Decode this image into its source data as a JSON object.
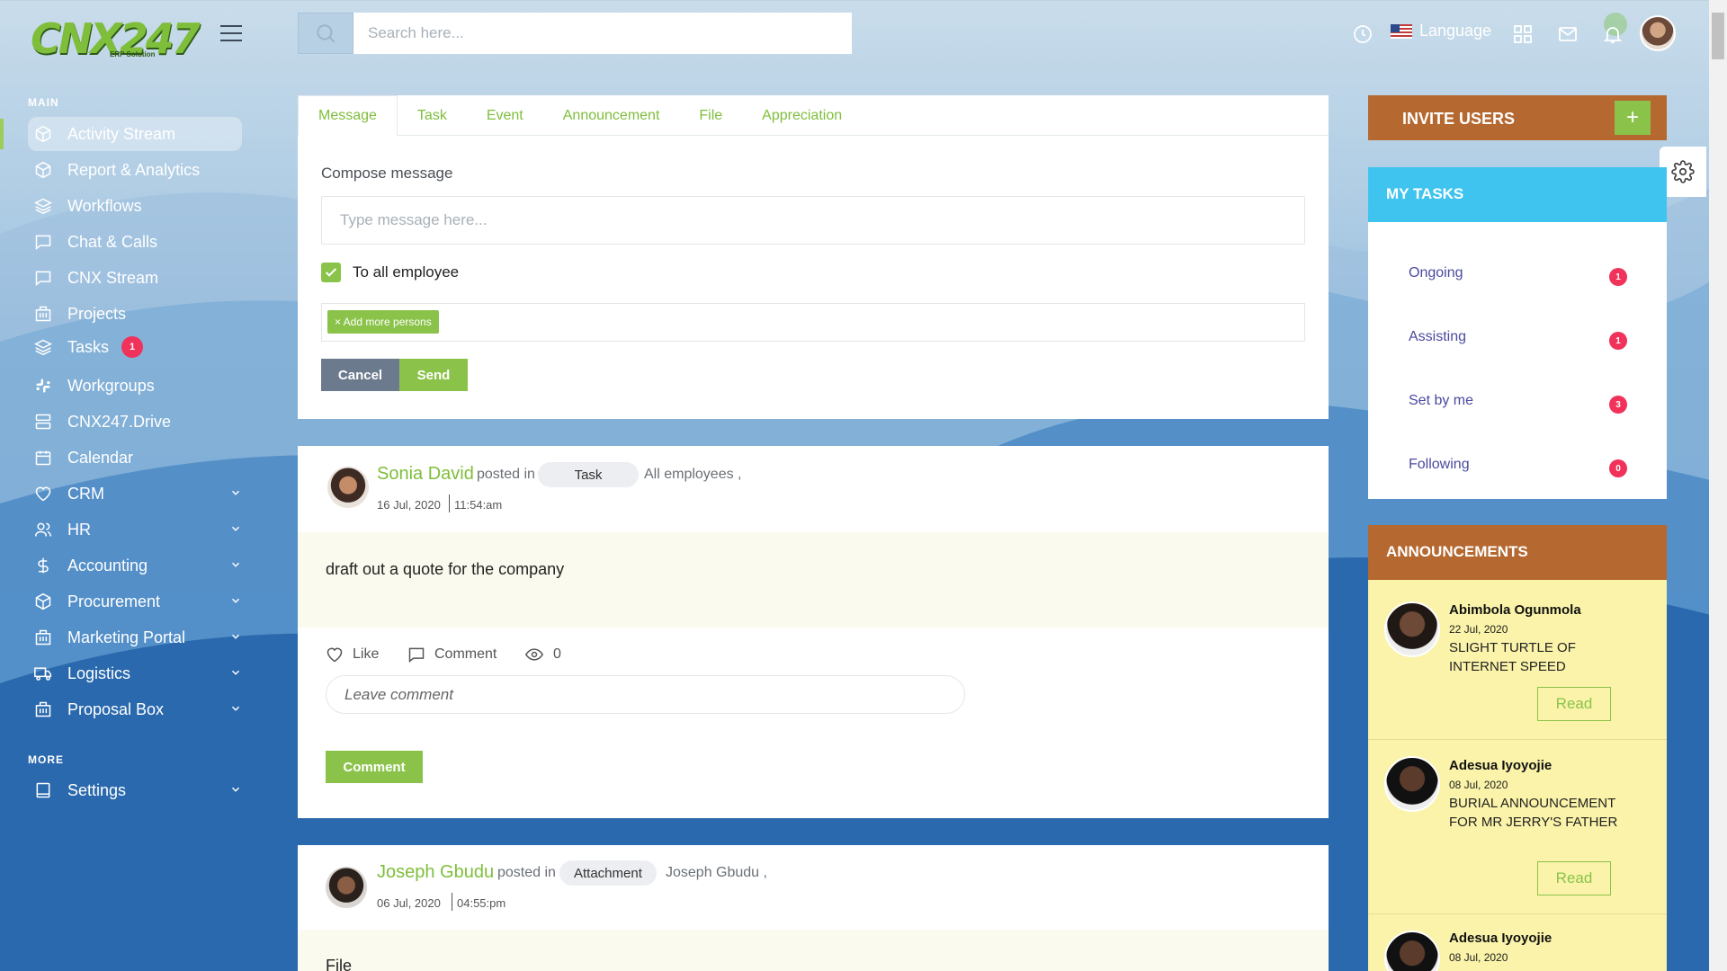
{
  "app": {
    "logo_text": "CNX247",
    "logo_sub": "ERP Solution"
  },
  "search": {
    "placeholder": "Search here..."
  },
  "topbar": {
    "language_label": "Language"
  },
  "sidebar": {
    "main_title": "MAIN",
    "more_title": "MORE",
    "items": [
      {
        "label": "Activity Stream",
        "icon": "cube-icon",
        "active": true
      },
      {
        "label": "Report & Analytics",
        "icon": "cube-icon"
      },
      {
        "label": "Workflows",
        "icon": "layers-icon"
      },
      {
        "label": "Chat & Calls",
        "icon": "chat-icon"
      },
      {
        "label": "CNX Stream",
        "icon": "chat-icon"
      },
      {
        "label": "Projects",
        "icon": "building-icon"
      },
      {
        "label": "Tasks",
        "icon": "layers-icon",
        "badge": "1"
      },
      {
        "label": "Workgroups",
        "icon": "slack-icon"
      },
      {
        "label": "CNX247.Drive",
        "icon": "server-icon"
      },
      {
        "label": "Calendar",
        "icon": "calendar-icon"
      },
      {
        "label": "CRM",
        "icon": "heart-icon",
        "expandable": true
      },
      {
        "label": "HR",
        "icon": "users-icon",
        "expandable": true
      },
      {
        "label": "Accounting",
        "icon": "dollar-icon",
        "expandable": true
      },
      {
        "label": "Procurement",
        "icon": "cube-icon",
        "expandable": true
      },
      {
        "label": "Marketing Portal",
        "icon": "building-icon",
        "expandable": true
      },
      {
        "label": "Logistics",
        "icon": "truck-icon",
        "expandable": true
      },
      {
        "label": "Proposal Box",
        "icon": "building-icon",
        "expandable": true
      }
    ],
    "more_items": [
      {
        "label": "Settings",
        "icon": "book-icon",
        "expandable": true
      }
    ]
  },
  "composer": {
    "tabs": [
      "Message",
      "Task",
      "Event",
      "Announcement",
      "File",
      "Appreciation"
    ],
    "active_tab": "Message",
    "compose_label": "Compose message",
    "message_placeholder": "Type message here...",
    "to_all_label": "To all employee",
    "to_all_checked": true,
    "add_persons_chip": "× Add more persons",
    "cancel_label": "Cancel",
    "send_label": "Send"
  },
  "posts": [
    {
      "author": "Sonia David",
      "posted_in": "posted in",
      "category": "Task",
      "audience": "All employees ,",
      "date": "16 Jul, 2020",
      "time": "11:54:am",
      "body": "draft out a quote for the company",
      "like_label": "Like",
      "comment_label": "Comment",
      "views": "0",
      "comment_placeholder": "Leave comment",
      "comment_button": "Comment"
    },
    {
      "author": "Joseph Gbudu",
      "posted_in": "posted in",
      "category": "Attachment",
      "audience": "Joseph Gbudu ,",
      "date": "06 Jul, 2020",
      "time": "04:55:pm",
      "body": "File"
    }
  ],
  "invite": {
    "title": "INVITE USERS",
    "plus": "+"
  },
  "my_tasks": {
    "title": "MY TASKS",
    "rows": [
      {
        "label": "Ongoing",
        "count": "1"
      },
      {
        "label": "Assisting",
        "count": "1"
      },
      {
        "label": "Set by me",
        "count": "3"
      },
      {
        "label": "Following",
        "count": "0"
      }
    ]
  },
  "announcements": {
    "title": "ANNOUNCEMENTS",
    "read_label": "Read",
    "items": [
      {
        "name": "Abimbola Ogunmola",
        "date": "22 Jul, 2020",
        "text": "SLIGHT TURTLE OF INTERNET SPEED"
      },
      {
        "name": "Adesua Iyoyojie",
        "date": "08 Jul, 2020",
        "text": "BURIAL ANNOUNCEMENT FOR MR JERRY'S FATHER"
      },
      {
        "name": "Adesua Iyoyojie",
        "date": "08 Jul, 2020",
        "text": ""
      }
    ]
  },
  "colors": {
    "accent_green": "#8bc34a",
    "brown": "#b5682f",
    "cyan": "#3fc4ef",
    "badge_red": "#f1325a"
  }
}
